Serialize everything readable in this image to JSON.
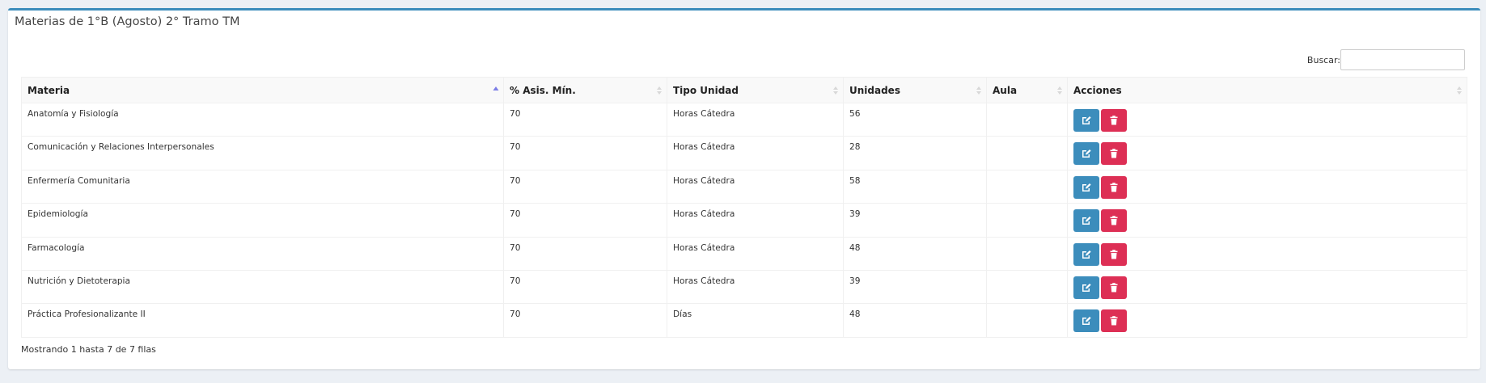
{
  "box": {
    "title": "Materias de 1°B (Agosto) 2° Tramo TM"
  },
  "search": {
    "label": "Buscar:",
    "value": ""
  },
  "table": {
    "headers": {
      "materia": "Materia",
      "asistencia": "% Asis. Mín.",
      "tipo_unidad": "Tipo Unidad",
      "unidades": "Unidades",
      "aula": "Aula",
      "acciones": "Acciones"
    },
    "sorted_column": "materia",
    "sort_direction": "ascending",
    "rows": [
      {
        "materia": "Anatomía y Fisiología",
        "asistencia": "70",
        "tipo_unidad": "Horas Cátedra",
        "unidades": "56",
        "aula": ""
      },
      {
        "materia": "Comunicación y Relaciones Interpersonales",
        "asistencia": "70",
        "tipo_unidad": "Horas Cátedra",
        "unidades": "28",
        "aula": ""
      },
      {
        "materia": "Enfermería Comunitaria",
        "asistencia": "70",
        "tipo_unidad": "Horas Cátedra",
        "unidades": "58",
        "aula": ""
      },
      {
        "materia": "Epidemiología",
        "asistencia": "70",
        "tipo_unidad": "Horas Cátedra",
        "unidades": "39",
        "aula": ""
      },
      {
        "materia": "Farmacología",
        "asistencia": "70",
        "tipo_unidad": "Horas Cátedra",
        "unidades": "48",
        "aula": ""
      },
      {
        "materia": "Nutrición y Dietoterapia",
        "asistencia": "70",
        "tipo_unidad": "Horas Cátedra",
        "unidades": "39",
        "aula": ""
      },
      {
        "materia": "Práctica Profesionalizante II",
        "asistencia": "70",
        "tipo_unidad": "Días",
        "unidades": "48",
        "aula": ""
      }
    ],
    "row_actions": [
      {
        "name": "edit",
        "icon": "edit-icon",
        "color": "#3c8dbc"
      },
      {
        "name": "delete",
        "icon": "trash-icon",
        "color": "#dd2f55"
      }
    ]
  },
  "footer": {
    "info": "Mostrando 1 hasta 7 de 7 filas"
  },
  "colors": {
    "accent": "#3c8dbc",
    "danger": "#dd2f55",
    "page_background": "#ecf0f5"
  }
}
